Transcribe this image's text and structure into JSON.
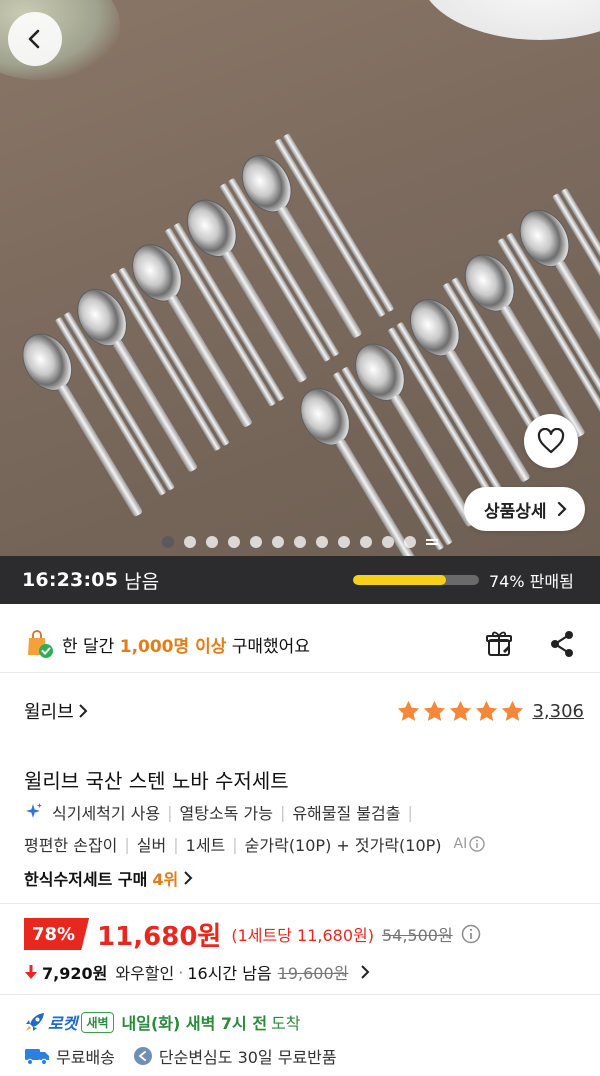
{
  "hero": {
    "image_desc": "stainless spoon and chopstick set",
    "detail_button": "상품상세",
    "page_count": 12,
    "active_index": 0
  },
  "timer": {
    "time": "16:23:05",
    "remain_label": "남음",
    "sold_text": "74% 판매됨",
    "sold_fraction": 0.74
  },
  "purchase": {
    "prefix": "한 달간 ",
    "highlight": "1,000명 이상",
    "suffix": " 구매했어요"
  },
  "brand": {
    "name": "윌리브"
  },
  "rating": {
    "stars": 5,
    "count": "3,306"
  },
  "product": {
    "title": "윌리브 국산 스텐 노바 수저세트",
    "attrs_line1": [
      "식기세척기 사용",
      "열탕소독 가능",
      "유해물질 불검출"
    ],
    "attrs_line2": [
      "평편한 손잡이",
      "실버",
      "1세트",
      "숟가락(10P) + 젓가락(10P)"
    ],
    "ai_label": "AI"
  },
  "rank": {
    "label": "한식수저세트 구매",
    "num": "4위"
  },
  "price": {
    "discount": "78%",
    "sale": "11,680원",
    "unit_price": "(1세트당 11,680원)",
    "original": "54,500원"
  },
  "coupon": {
    "amount": "7,920원",
    "label": "와우할인",
    "time": "16시간 남음",
    "strike": "19,600원"
  },
  "delivery": {
    "rocket": "로켓",
    "badge": "새벽",
    "date": "내일(화) 새벽 7시 전",
    "arrive": "도착"
  },
  "shipping": {
    "free": "무료배송",
    "return": "단순변심도 30일 무료반품"
  },
  "colors": {
    "red": "#e8281f",
    "orange": "#e27d17",
    "green": "#2c8a3d",
    "blue": "#1f69c9",
    "star": "#f5873a"
  }
}
